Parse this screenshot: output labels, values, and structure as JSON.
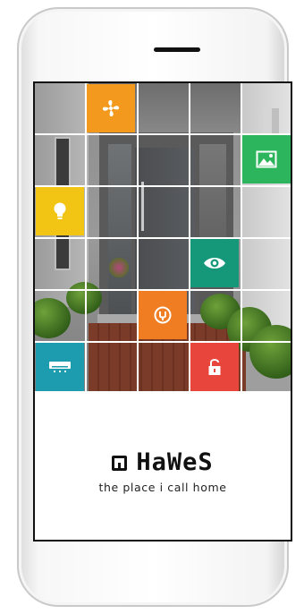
{
  "tiles": [
    {
      "id": "fan",
      "icon": "fan-icon",
      "color": "#F39A1E"
    },
    {
      "id": "gallery",
      "icon": "image-icon",
      "color": "#2DB55D"
    },
    {
      "id": "lighting",
      "icon": "lightbulb-icon",
      "color": "#F2C515"
    },
    {
      "id": "camera",
      "icon": "eye-icon",
      "color": "#15987A"
    },
    {
      "id": "power",
      "icon": "power-icon",
      "color": "#F07D22"
    },
    {
      "id": "climate",
      "icon": "air-conditioner-icon",
      "color": "#1D9CB0"
    },
    {
      "id": "lock",
      "icon": "padlock-icon",
      "color": "#E8453C"
    }
  ],
  "brand": {
    "name": "HaWeS",
    "tagline": "the place i call home"
  }
}
